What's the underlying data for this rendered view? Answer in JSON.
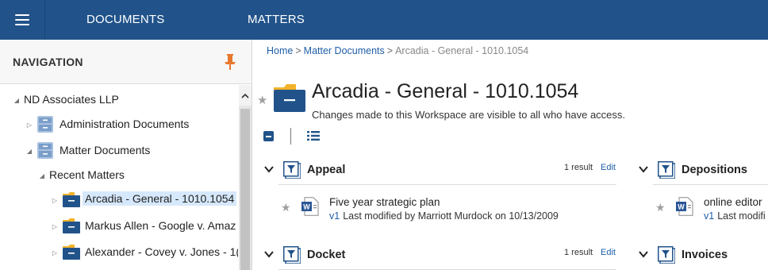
{
  "topbar": {
    "menu_icon": "hamburger-icon",
    "tabs": [
      {
        "label": "DOCUMENTS"
      },
      {
        "label": "MATTERS"
      }
    ],
    "background": "#21538a"
  },
  "sidebar": {
    "title": "NAVIGATION",
    "pin_icon": "pin-icon",
    "pin_color": "#e8772e",
    "tree": [
      {
        "label": "ND Associates LLP",
        "expanded": true
      },
      {
        "label": "Administration Documents",
        "expanded": false,
        "icon": "cabinet-icon"
      },
      {
        "label": "Matter Documents",
        "expanded": true,
        "icon": "cabinet-icon"
      },
      {
        "label": "Recent Matters",
        "expanded": true
      },
      {
        "label": "Arcadia - General - 1010.1054",
        "expanded": false,
        "icon": "folder-icon",
        "selected": true
      },
      {
        "label": "Markus Allen - Google v. Amaz",
        "expanded": false,
        "icon": "folder-icon"
      },
      {
        "label": "Alexander - Covey v. Jones - 1(",
        "expanded": false,
        "icon": "folder-icon"
      }
    ]
  },
  "main": {
    "breadcrumb": {
      "home": "Home",
      "sep": ">",
      "parent": "Matter Documents",
      "current": "Arcadia - General - 1010.1054"
    },
    "workspace": {
      "title": "Arcadia - General - 1010.1054",
      "description": "Changes made to this Workspace are visible to all who have access."
    },
    "sections": [
      {
        "title": "Appeal",
        "count": "1 result",
        "edit": "Edit",
        "items": [
          {
            "name": "Five year strategic plan",
            "version": "v1",
            "modified": "Last modified by Marriott Murdock on 10/13/2009"
          }
        ]
      },
      {
        "title": "Depositions",
        "items": [
          {
            "name": "online editor",
            "version": "v1",
            "modified": "Last modifi"
          }
        ]
      },
      {
        "title": "Docket",
        "count": "1 result",
        "edit": "Edit"
      },
      {
        "title": "Invoices"
      }
    ],
    "accent": "#1f5fa8",
    "folder_color": "#21538a",
    "folder_tab_color": "#f2b32a"
  }
}
